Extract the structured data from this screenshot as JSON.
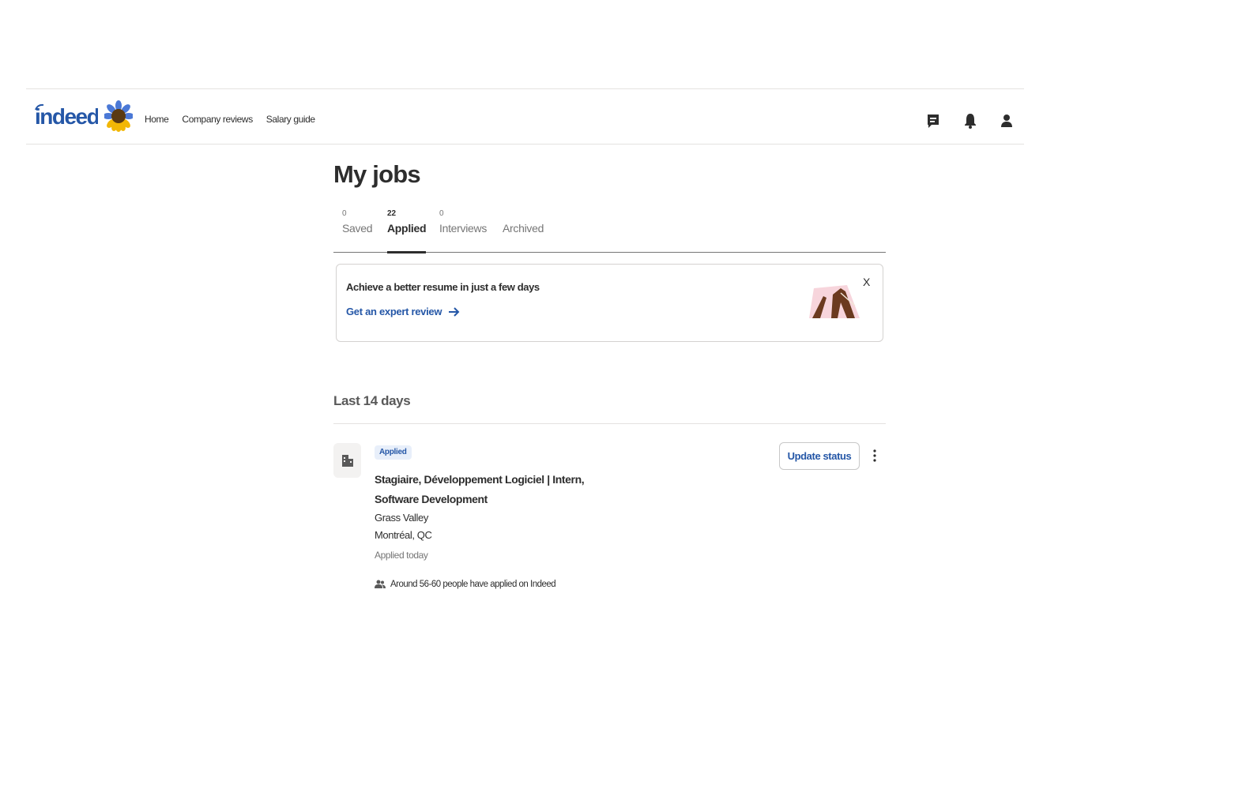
{
  "header": {
    "logo_text": "indeed",
    "nav": [
      {
        "label": "Home"
      },
      {
        "label": "Company reviews"
      },
      {
        "label": "Salary guide"
      }
    ],
    "icons": [
      "messages-icon",
      "notifications-bell-icon",
      "profile-icon"
    ]
  },
  "main": {
    "title": "My jobs",
    "tabs": [
      {
        "count": "0",
        "label": "Saved",
        "active": false
      },
      {
        "count": "22",
        "label": "Applied",
        "active": true
      },
      {
        "count": "0",
        "label": "Interviews",
        "active": false
      },
      {
        "count": "",
        "label": "Archived",
        "active": false
      }
    ],
    "promo": {
      "title": "Achieve a better resume in just a few days",
      "link": "Get an expert review",
      "close_label": "X"
    },
    "section_title": "Last 14 days",
    "jobs": [
      {
        "status": "Applied",
        "title": "Stagiaire, Développement Logiciel | Intern, Software Development",
        "company": "Grass Valley",
        "location": "Montréal, QC",
        "applied": "Applied today",
        "applicants": "Around 56-60 people have applied on Indeed",
        "update_label": "Update status"
      }
    ]
  },
  "colors": {
    "brand_blue": "#2557a7",
    "text": "#2d2d2d",
    "muted": "#767676",
    "badge_bg": "#e8effa"
  }
}
